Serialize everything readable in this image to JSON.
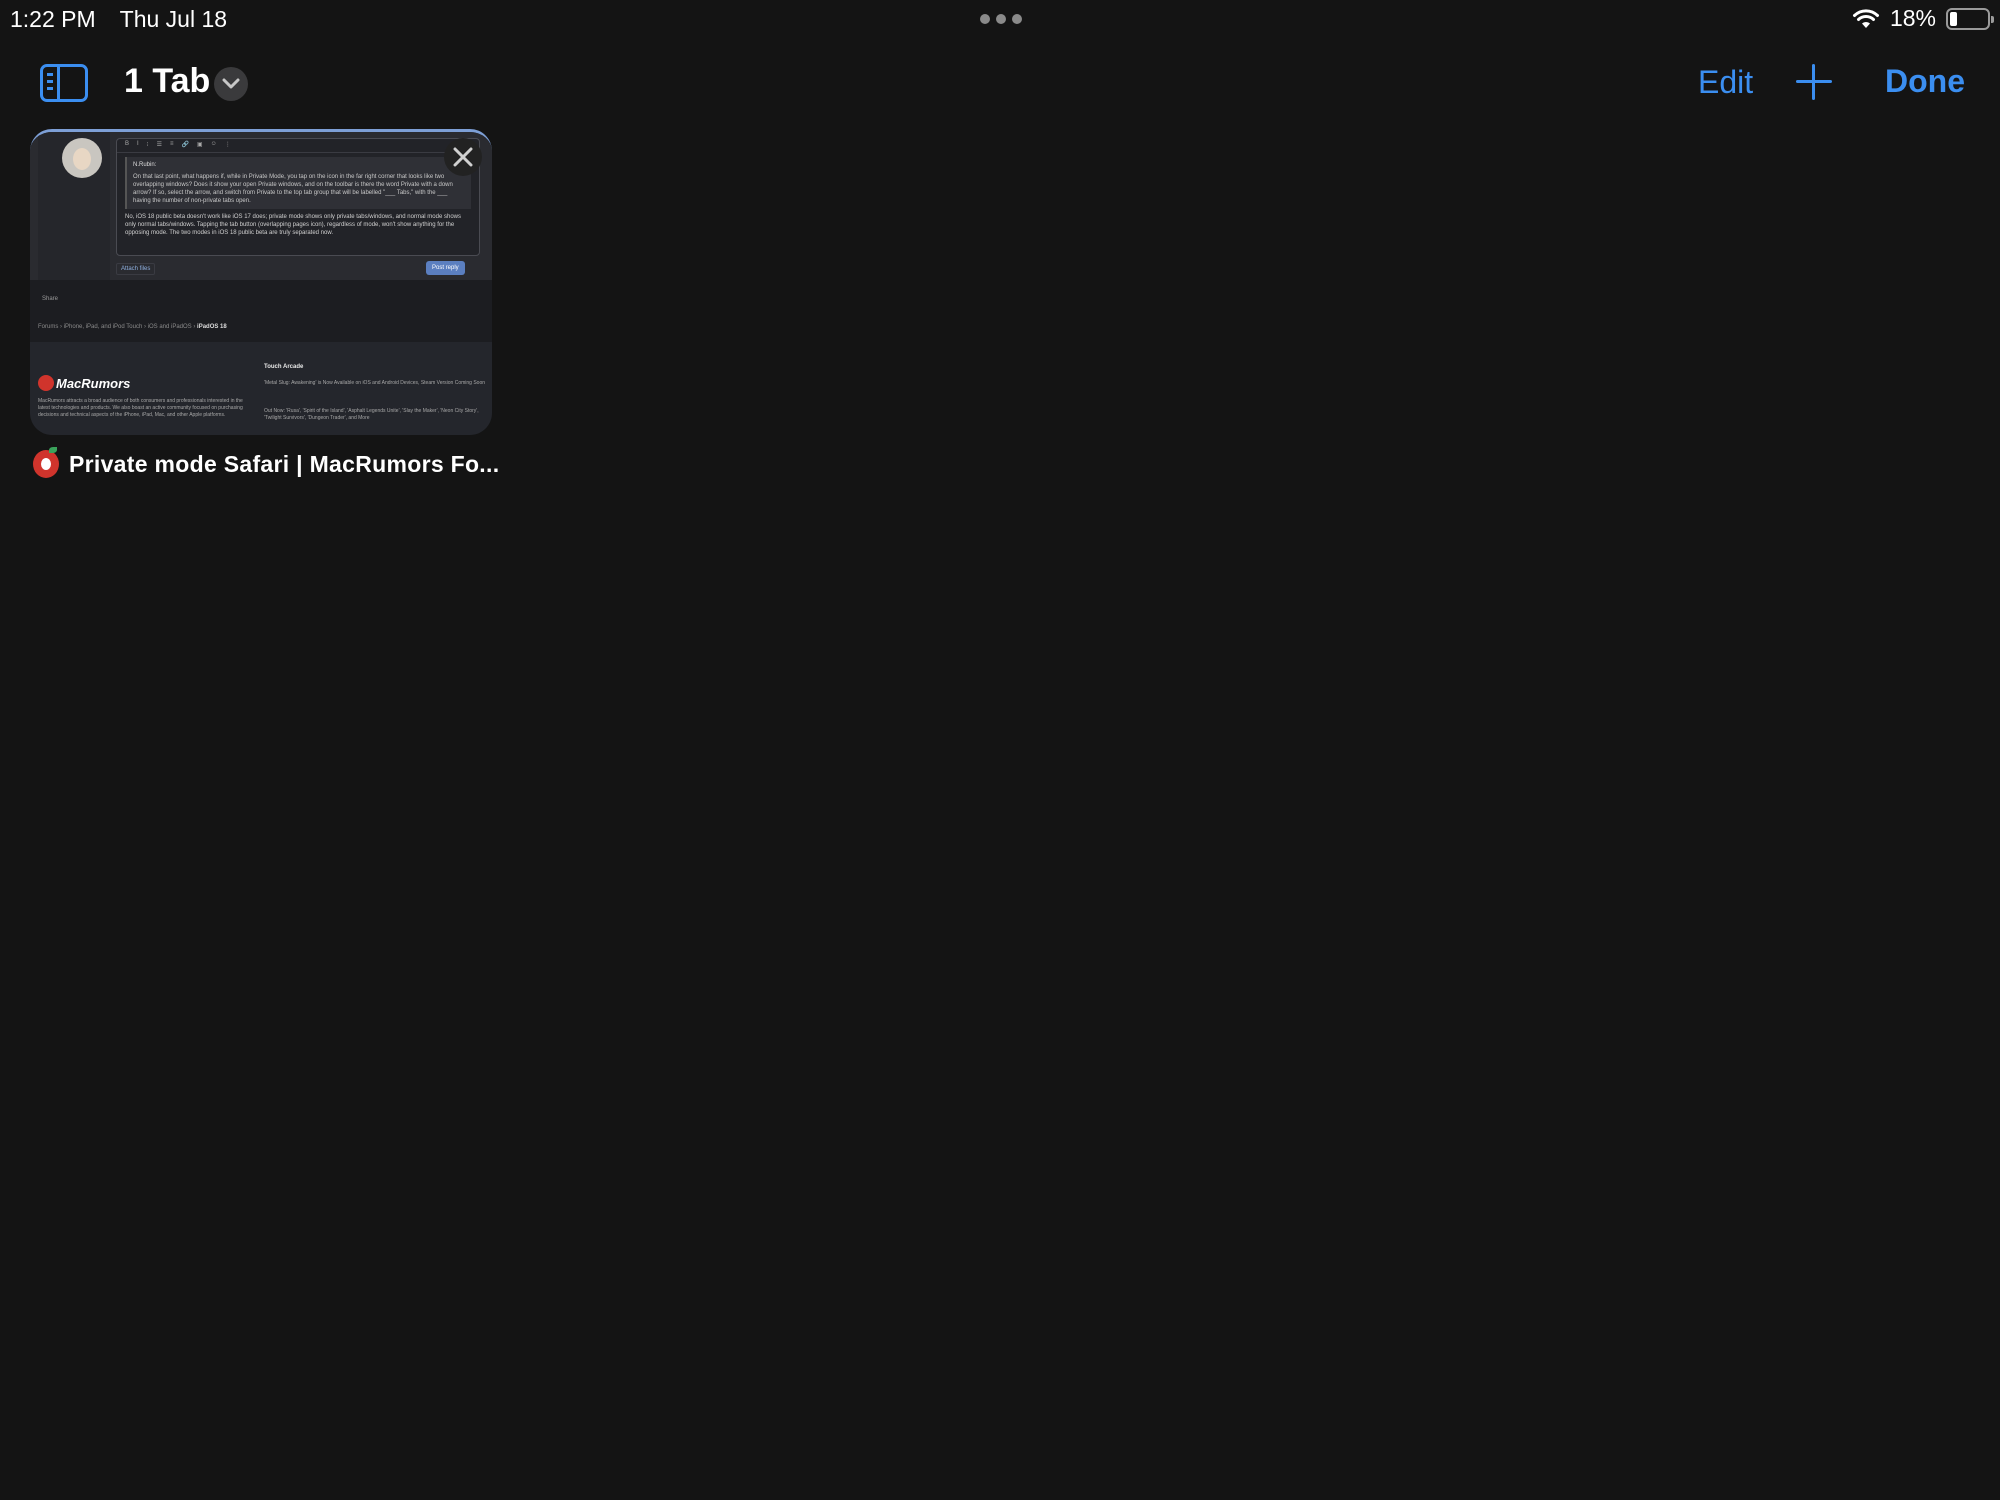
{
  "status_bar": {
    "time": "1:22 PM",
    "date": "Thu Jul 18",
    "battery": "18%",
    "battery_level": 0.18,
    "icons": [
      "multitasking-dots-icon",
      "wifi-icon",
      "battery-icon"
    ]
  },
  "toolbar": {
    "tab_count_title": "1 Tab",
    "edit_label": "Edit",
    "done_label": "Done",
    "icons": [
      "sidebar-icon",
      "chevron-down-icon",
      "plus-icon"
    ]
  },
  "tabs": [
    {
      "title": "Private mode Safari | MacRumors Fo...",
      "favicon": "macrumors-favicon-icon",
      "thumbnail": {
        "quote_author": "N.Rubin:",
        "quote_text": "On that last point, what happens if, while in Private Mode, you tap on the icon in the far right corner that looks like two overlapping windows? Does it show your open Private windows, and on the toolbar is there the word Private with a down arrow? If so, select the arrow, and switch from Private to the top tab group that will be labelled \"___ Tabs,\" with the ___ having the number of non-private tabs open.",
        "reply_text": "No, iOS 18 public beta doesn't work like iOS 17 does; private mode shows only private tabs/windows, and normal mode shows only normal tabs/windows. Tapping the tab button (overlapping pages icon), regardless of mode, won't show anything for the opposing mode. The two modes in iOS 18 public beta are truly separated now.",
        "attach_files": "Attach files",
        "post_reply": "Post reply",
        "share": "Share",
        "breadcrumbs": [
          "Forums",
          "iPhone, iPad, and iPod Touch",
          "iOS and iPadOS",
          "iPadOS 18"
        ],
        "logo_text": "MacRumors",
        "about_text": "MacRumors attracts a broad audience of both consumers and professionals interested in the latest technologies and products. We also boast an active community focused on purchasing decisions and technical aspects of the iPhone, iPad, Mac, and other Apple platforms.",
        "touch_arcade_title": "Touch Arcade",
        "touch_arcade_item1": "'Metal Slug: Awakening' is Now Available on iOS and Android Devices, Steam Version Coming Soon",
        "touch_arcade_item2": "Out Now: 'Rusa', 'Spirit of the Island', 'Asphalt Legends Unite', 'Slay the Maker', 'Neon City Story', 'Twilight Survivors', 'Dungeon Trader', and More"
      }
    }
  ],
  "colors": {
    "background": "#141414",
    "accent": "#3b8ef0",
    "text": "#ffffff"
  }
}
